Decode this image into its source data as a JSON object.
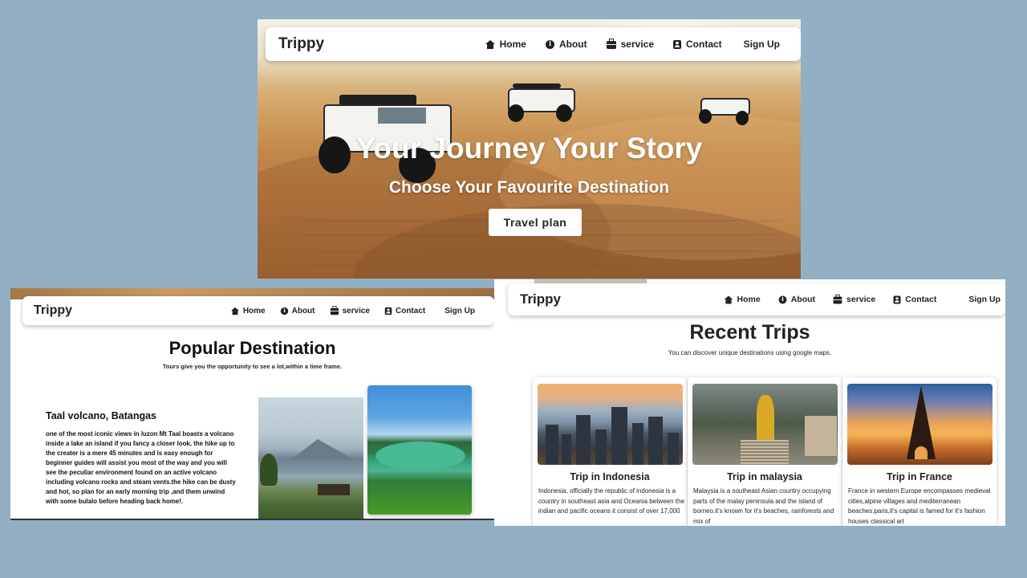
{
  "nav": {
    "brand": "Trippy",
    "links": [
      "Home",
      "About",
      "service",
      "Contact"
    ],
    "signup": "Sign Up"
  },
  "hero": {
    "title": "Your Journey Your Story",
    "subtitle": "Choose Your Favourite Destination",
    "button": "Travel plan"
  },
  "popular": {
    "title": "Popular Destination",
    "subtitle": "Tours give you the opportunity to see a lot,within a time frame.",
    "place": "Taal volcano, Batangas",
    "description": "one of the most iconic views in luzon Mt Taal boasts a volcano inside a lake an island if you fancy a closer look, the hike up to the creater is a mere 45 minutes and is easy enough for beginner guides will assist you most of the way and you will see the peculiar environment found on an active volcano including volcano rocks and steam vents.the hike can be dusty and hot, so plan for an early morning trip ,and them unwind with some bulalo before heading back home!."
  },
  "recent": {
    "title": "Recent Trips",
    "subtitle": "You can discover unique destinations using google maps.",
    "trips": [
      {
        "name": "Trip in Indonesia",
        "text": "Indonesia, officially the republic of indonesia is a country in southeast asia and Oceania between the indian and pacific oceans it consist of over 17,000"
      },
      {
        "name": "Trip in malaysia",
        "text": "Malaysia is a southeast Asian country occupying parts of the malay peninsula and the island of borneo.it's known for it's beaches, rainforests and mix of"
      },
      {
        "name": "Trip in France",
        "text": "France in western Europe encompasses medieval cities,alpine villages and mediterranean beaches.paris,it's capital is famed for it's fashion houses classical art"
      }
    ]
  },
  "colors": {
    "background": "#93afc4",
    "text": "#222222",
    "navbar": "#ffffff"
  },
  "icons": [
    "home-icon",
    "info-icon",
    "briefcase-icon",
    "contact-card-icon"
  ]
}
